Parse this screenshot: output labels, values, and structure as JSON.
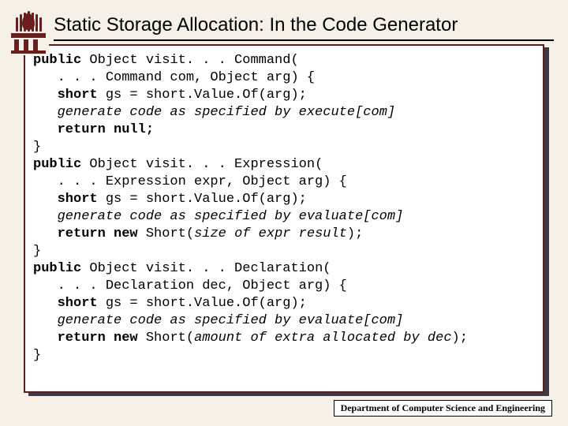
{
  "title": "Static Storage Allocation: In the Code Generator",
  "footer": "Department of Computer Science and Engineering",
  "code": {
    "l1_kw": "public",
    "l1_rest": " Object visit. . . Command(",
    "l2": "   . . . Command com, Object arg) {",
    "l3_pre": "   ",
    "l3_kw": "short",
    "l3_rest": " gs = short.Value.Of(arg);",
    "l4": "   generate code as specified by execute[com]",
    "l5_pre": "   ",
    "l5_kw": "return null;",
    "l6": "}",
    "l7_kw": "public",
    "l7_rest": " Object visit. . . Expression(",
    "l8": "   . . . Expression expr, Object arg) {",
    "l9_pre": "   ",
    "l9_kw": "short",
    "l9_rest": " gs = short.Value.Of(arg);",
    "l10": "   generate code as specified by evaluate[com]",
    "l11_pre": "   ",
    "l11_kw": "return new",
    "l11_mid": " Short(",
    "l11_it": "size of expr result",
    "l11_end": ");",
    "l12": "}",
    "l13_kw": "public",
    "l13_rest": " Object visit. . . Declaration(",
    "l14": "   . . . Declaration dec, Object arg) {",
    "l15_pre": "   ",
    "l15_kw": "short",
    "l15_rest": " gs = short.Value.Of(arg);",
    "l16": "   generate code as specified by evaluate[com]",
    "l17_pre": "   ",
    "l17_kw": "return new",
    "l17_mid": " Short(",
    "l17_it": "amount of extra allocated by dec",
    "l17_end": ");",
    "l18": "}"
  }
}
